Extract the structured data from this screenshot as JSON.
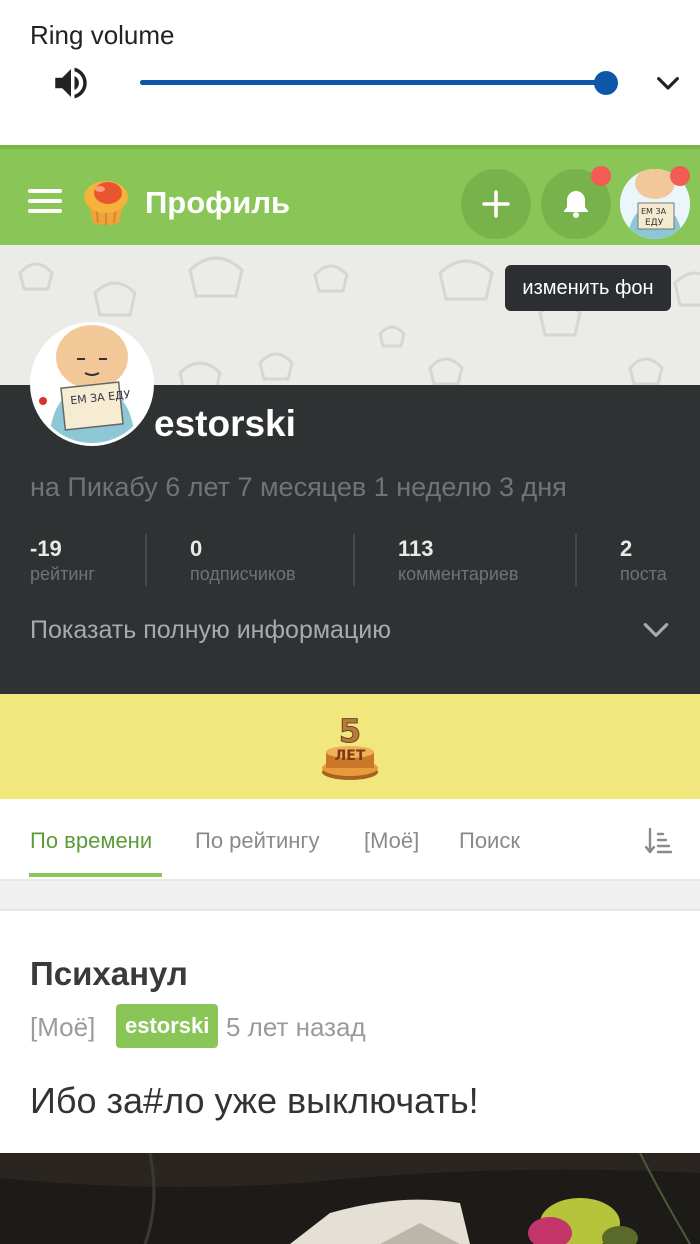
{
  "volume": {
    "title": "Ring volume",
    "level": 0.995,
    "accent": "#0d57a8"
  },
  "header": {
    "title": "Профиль",
    "background": "#89c657",
    "icons": [
      "menu-icon",
      "cupcake-logo-icon",
      "plus-icon",
      "bell-icon"
    ]
  },
  "profile": {
    "change_bg_label": "изменить фон",
    "username": "estorski",
    "member_since": "на Пикабу 6 лет 7 месяцев 1 неделю 3 дня",
    "avatar_sign_text": "ЕМ ЗА ЕДУ",
    "stats": [
      {
        "value": "-19",
        "label": "рейтинг"
      },
      {
        "value": "0",
        "label": "подписчиков"
      },
      {
        "value": "113",
        "label": "комментариев"
      },
      {
        "value": "2",
        "label": "поста"
      }
    ],
    "show_info_label": "Показать полную информацию"
  },
  "award": {
    "number": "5",
    "label": "ЛЕТ"
  },
  "tabs": [
    {
      "label": "По времени",
      "active": true
    },
    {
      "label": "По рейтингу",
      "active": false
    },
    {
      "label": "[Моё]",
      "active": false
    },
    {
      "label": "Поиск",
      "active": false
    }
  ],
  "post": {
    "title": "Психанул",
    "tag": "[Моё]",
    "author": "estorski",
    "time": "5 лет назад",
    "text": "Ибо за#ло уже выключать!"
  }
}
